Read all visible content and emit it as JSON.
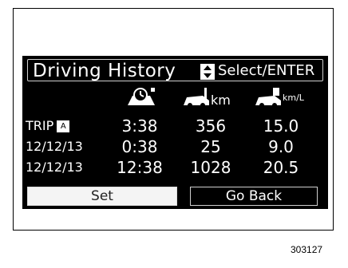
{
  "screen": {
    "title": "Driving History",
    "select_hint": "Select/ENTER",
    "columns": [
      {
        "icon": "clock-icon",
        "unit": ""
      },
      {
        "icon": "distance-car-icon",
        "unit": "km"
      },
      {
        "icon": "fuel-economy-car-icon",
        "unit": "km/L"
      }
    ],
    "rows": [
      {
        "label": "TRIP",
        "badge": "A",
        "time": "3:38",
        "distance": "356",
        "economy": "15.0"
      },
      {
        "label": "12/12/13",
        "badge": "",
        "time": "0:38",
        "distance": "25",
        "economy": "9.0"
      },
      {
        "label": "12/12/13",
        "badge": "",
        "time": "12:38",
        "distance": "1028",
        "economy": "20.5"
      }
    ],
    "buttons": {
      "set": "Set",
      "back": "Go Back"
    }
  },
  "figure_code": "303127"
}
